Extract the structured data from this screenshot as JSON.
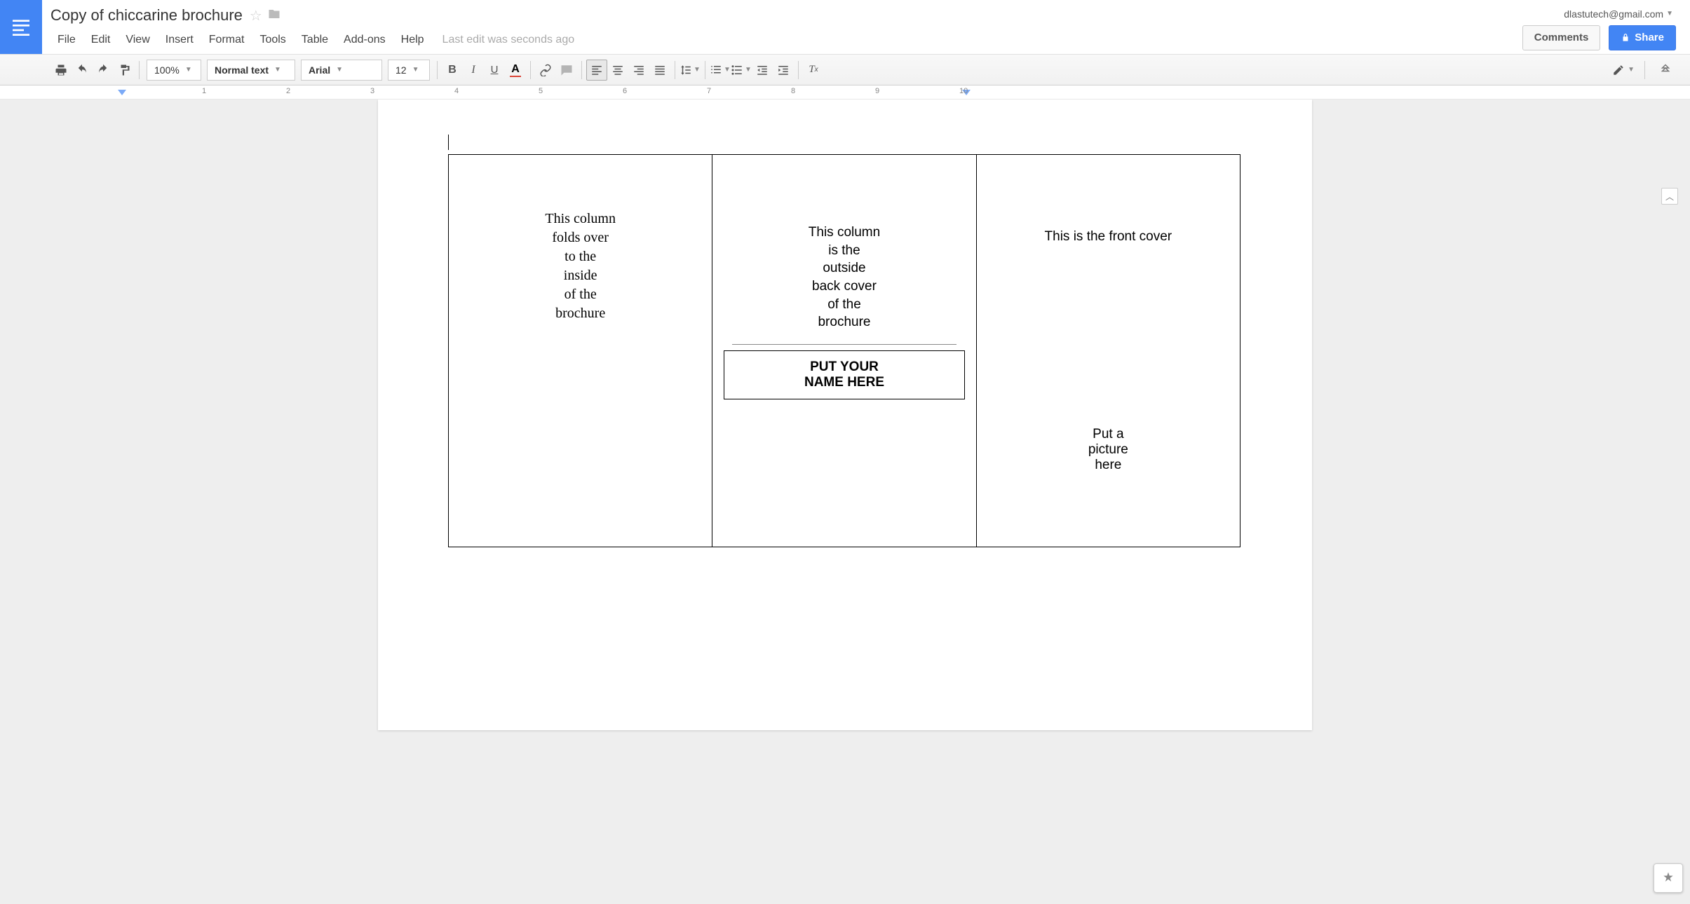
{
  "header": {
    "doc_title": "Copy of chiccarine brochure",
    "account_email": "dlastutech@gmail.com",
    "comments_label": "Comments",
    "share_label": "Share"
  },
  "menubar": {
    "items": [
      "File",
      "Edit",
      "View",
      "Insert",
      "Format",
      "Tools",
      "Table",
      "Add-ons",
      "Help"
    ],
    "last_edit": "Last edit was seconds ago"
  },
  "toolbar": {
    "zoom": "100%",
    "para_style": "Normal text",
    "font": "Arial",
    "font_size": "12"
  },
  "ruler": {
    "marks": [
      "1",
      "2",
      "3",
      "4",
      "5",
      "6",
      "7",
      "8",
      "9",
      "10"
    ]
  },
  "document": {
    "col1": "This column\nfolds over\nto the\ninside\nof the\nbrochure",
    "col2_top": "This column\nis the\noutside\nback cover\nof the\nbrochure",
    "col2_namebox": "PUT YOUR\nNAME HERE",
    "col3_front": "This is the front cover",
    "col3_picture": "Put a\npicture\nhere"
  }
}
